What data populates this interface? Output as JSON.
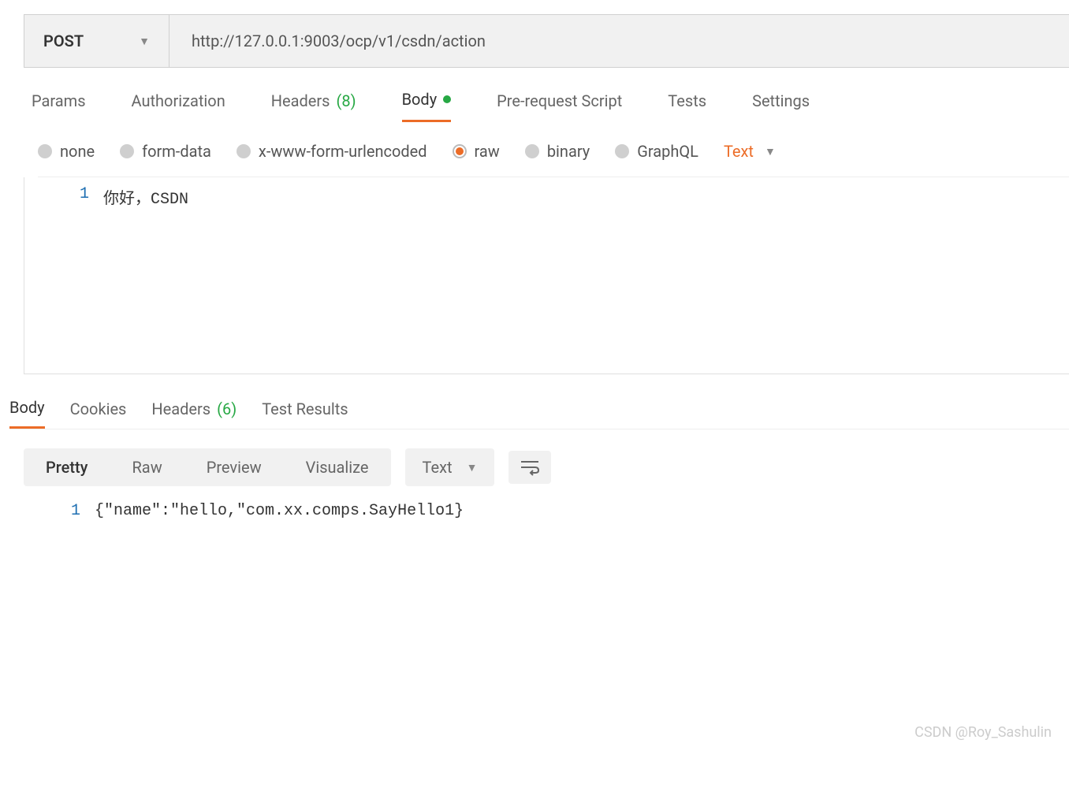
{
  "request": {
    "method": "POST",
    "url": "http://127.0.0.1:9003/ocp/v1/csdn/action"
  },
  "tabs": {
    "params": "Params",
    "authorization": "Authorization",
    "headers_label": "Headers",
    "headers_count": "(8)",
    "body": "Body",
    "prerequest": "Pre-request Script",
    "tests": "Tests",
    "settings": "Settings"
  },
  "body_types": {
    "none": "none",
    "form_data": "form-data",
    "xwww": "x-www-form-urlencoded",
    "raw": "raw",
    "binary": "binary",
    "graphql": "GraphQL",
    "format_label": "Text"
  },
  "request_editor": {
    "line_number": "1",
    "content": "你好，CSDN"
  },
  "response_tabs": {
    "body": "Body",
    "cookies": "Cookies",
    "headers_label": "Headers",
    "headers_count": "(6)",
    "test_results": "Test Results"
  },
  "view_modes": {
    "pretty": "Pretty",
    "raw": "Raw",
    "preview": "Preview",
    "visualize": "Visualize",
    "format_label": "Text"
  },
  "response_editor": {
    "line_number": "1",
    "content": "{\"name\":\"hello,\"com.xx.comps.SayHello1}"
  },
  "watermark": "CSDN @Roy_Sashulin"
}
